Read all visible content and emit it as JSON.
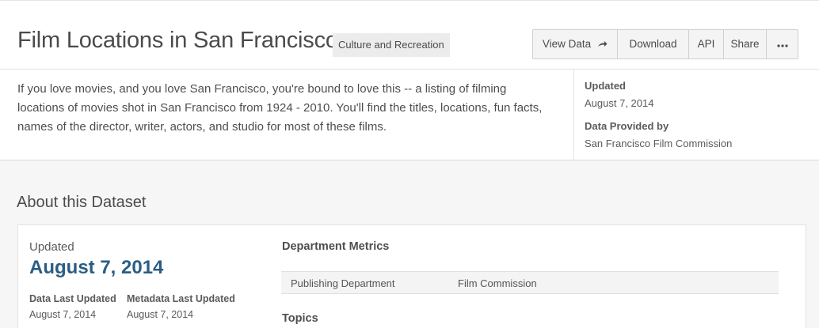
{
  "header": {
    "title": "Film Locations in San Francisco",
    "category": "Culture and Recreation",
    "buttons": {
      "view_data": "View Data",
      "download": "Download",
      "api": "API",
      "share": "Share",
      "more_icon": "ellipsis-icon"
    },
    "description": "If you love movies, and you love San Francisco, you're bound to love this -- a listing of filming locations of movies shot in San Francisco from 1924 - 2010. You'll find the titles, locations, fun facts, names of the director, writer, actors, and studio for most of these films.",
    "meta": {
      "updated_label": "Updated",
      "updated_value": "August 7, 2014",
      "provided_label": "Data Provided by",
      "provided_value": "San Francisco Film Commission"
    }
  },
  "about": {
    "section_title": "About this Dataset",
    "updated_label": "Updated",
    "updated_date": "August 7, 2014",
    "data_last_updated_label": "Data Last Updated",
    "data_last_updated_value": "August 7, 2014",
    "metadata_last_updated_label": "Metadata Last Updated",
    "metadata_last_updated_value": "August 7, 2014",
    "department_metrics_title": "Department Metrics",
    "metrics": [
      {
        "key": "Publishing Department",
        "value": "Film Commission"
      }
    ],
    "topics_title": "Topics"
  },
  "colors": {
    "accent": "#2a5d84",
    "page_bg": "#f6f6f6",
    "tag_bg": "#ececec"
  }
}
